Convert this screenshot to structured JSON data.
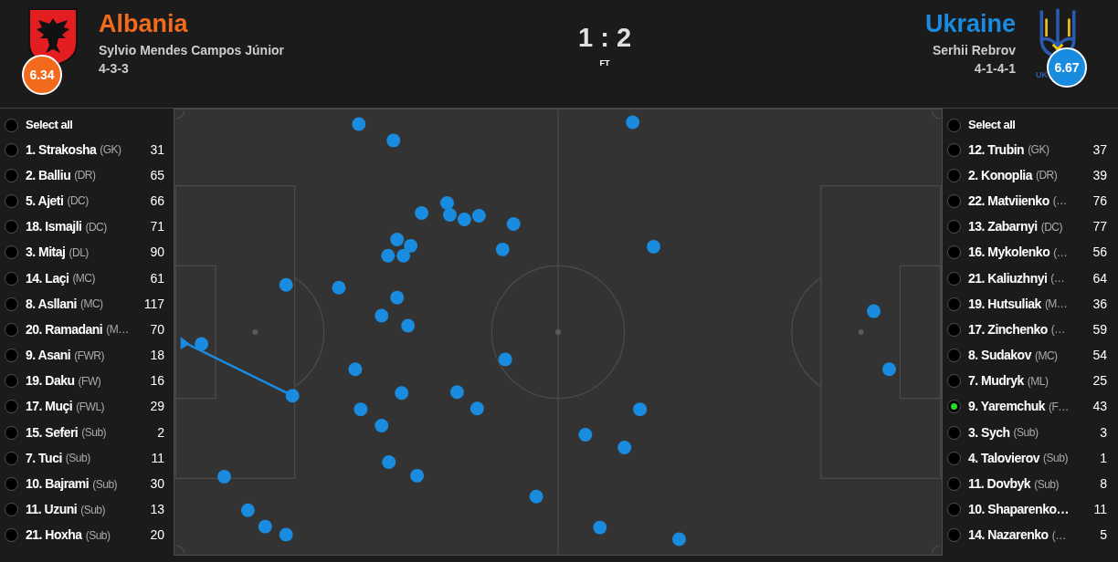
{
  "home": {
    "name": "Albania",
    "manager": "Sylvio Mendes Campos Júnior",
    "formation": "4-3-3",
    "rating": "6.34",
    "color": "#f26a1b"
  },
  "score": {
    "result": "1 : 2",
    "status": "FT"
  },
  "away": {
    "name": "Ukraine",
    "manager": "Serhii Rebrov",
    "formation": "4-1-4-1",
    "rating": "6.67",
    "color": "#1a8ce0",
    "logo_text": "UK"
  },
  "home_players": {
    "select_all": {
      "label": "Select all",
      "selected": false
    },
    "items": [
      {
        "name": "1. Strakosha",
        "position": "(GK)",
        "count": "31",
        "selected": false
      },
      {
        "name": "2. Balliu",
        "position": "(DR)",
        "count": "65",
        "selected": false
      },
      {
        "name": "5. Ajeti",
        "position": "(DC)",
        "count": "66",
        "selected": false
      },
      {
        "name": "18. Ismajli",
        "position": "(DC)",
        "count": "71",
        "selected": false
      },
      {
        "name": "3. Mitaj",
        "position": "(DL)",
        "count": "90",
        "selected": false
      },
      {
        "name": "14. Laçi",
        "position": "(MC)",
        "count": "61",
        "selected": false
      },
      {
        "name": "8. Asllani",
        "position": "(MC)",
        "count": "117",
        "selected": false
      },
      {
        "name": "20. Ramadani",
        "position": "(M…",
        "count": "70",
        "selected": false
      },
      {
        "name": "9. Asani",
        "position": "(FWR)",
        "count": "18",
        "selected": false
      },
      {
        "name": "19. Daku",
        "position": "(FW)",
        "count": "16",
        "selected": false
      },
      {
        "name": "17. Muçi",
        "position": "(FWL)",
        "count": "29",
        "selected": false
      },
      {
        "name": "15. Seferi",
        "position": "(Sub)",
        "count": "2",
        "selected": false
      },
      {
        "name": "7. Tuci",
        "position": "(Sub)",
        "count": "11",
        "selected": false
      },
      {
        "name": "10. Bajrami",
        "position": "(Sub)",
        "count": "30",
        "selected": false
      },
      {
        "name": "11. Uzuni",
        "position": "(Sub)",
        "count": "13",
        "selected": false
      },
      {
        "name": "21. Hoxha",
        "position": "(Sub)",
        "count": "20",
        "selected": false
      }
    ]
  },
  "away_players": {
    "select_all": {
      "label": "Select all",
      "selected": false
    },
    "items": [
      {
        "name": "12. Trubin",
        "position": "(GK)",
        "count": "37",
        "selected": false
      },
      {
        "name": "2. Konoplia",
        "position": "(DR)",
        "count": "39",
        "selected": false
      },
      {
        "name": "22. Matviienko",
        "position": "(…",
        "count": "76",
        "selected": false
      },
      {
        "name": "13. Zabarnyi",
        "position": "(DC)",
        "count": "77",
        "selected": false
      },
      {
        "name": "16. Mykolenko",
        "position": "(…",
        "count": "56",
        "selected": false
      },
      {
        "name": "21. Kaliuzhnyi",
        "position": "(…",
        "count": "64",
        "selected": false
      },
      {
        "name": "19. Hutsuliak",
        "position": "(M…",
        "count": "36",
        "selected": false
      },
      {
        "name": "17. Zinchenko",
        "position": "(…",
        "count": "59",
        "selected": false
      },
      {
        "name": "8. Sudakov",
        "position": "(MC)",
        "count": "54",
        "selected": false
      },
      {
        "name": "7. Mudryk",
        "position": "(ML)",
        "count": "25",
        "selected": false
      },
      {
        "name": "9. Yaremchuk",
        "position": "(F…",
        "count": "43",
        "selected": true
      },
      {
        "name": "3. Sych",
        "position": "(Sub)",
        "count": "3",
        "selected": false
      },
      {
        "name": "4. Talovierov",
        "position": "(Sub)",
        "count": "1",
        "selected": false
      },
      {
        "name": "11. Dovbyk",
        "position": "(Sub)",
        "count": "8",
        "selected": false
      },
      {
        "name": "10. Shaparenko…",
        "count": "11",
        "selected": false
      },
      {
        "name": "14. Nazarenko",
        "position": "(…",
        "count": "5",
        "selected": false
      }
    ]
  }
}
